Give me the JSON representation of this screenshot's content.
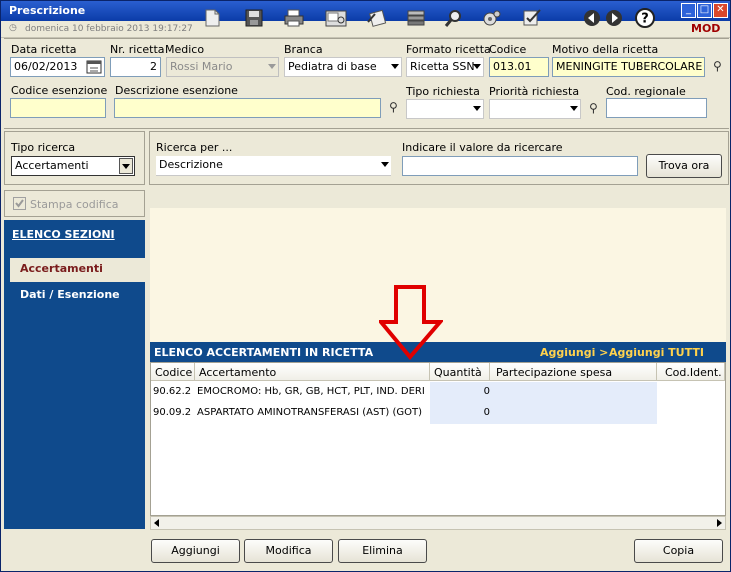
{
  "window": {
    "title": "Prescrizione",
    "date_info": "domenica 10 febbraio 2013   19:17:27",
    "mode": "MOD"
  },
  "toolbar": {
    "icons": [
      "new-doc-icon",
      "save-icon",
      "print-icon",
      "print-preview-icon",
      "attach-icon",
      "stack-icon",
      "search-icon",
      "settings-icon",
      "check-edit-icon",
      "prev-icon",
      "next-icon",
      "help-icon"
    ]
  },
  "header": {
    "data_ricetta_label": "Data ricetta",
    "data_ricetta_value": "06/02/2013",
    "nr_ricetta_label": "Nr. ricetta",
    "nr_ricetta_value": "2",
    "medico_label": "Medico",
    "medico_value": "Rossi Mario",
    "branca_label": "Branca",
    "branca_value": "Pediatra di base",
    "formato_label": "Formato ricetta",
    "formato_value": "Ricetta SSN",
    "codice_label": "Codice",
    "codice_value": "013.01",
    "motivo_label": "Motivo della ricetta",
    "motivo_value": "MENINGITE TUBERCOLARE",
    "codice_esenzione_label": "Codice esenzione",
    "codice_esenzione_value": "",
    "descrizione_esenzione_label": "Descrizione esenzione",
    "descrizione_esenzione_value": "",
    "tipo_richiesta_label": "Tipo richiesta",
    "tipo_richiesta_value": "",
    "priorita_label": "Priorità richiesta",
    "priorita_value": "",
    "cod_regionale_label": "Cod. regionale",
    "cod_regionale_value": ""
  },
  "search": {
    "tipo_ricerca_label": "Tipo ricerca",
    "tipo_ricerca_value": "Accertamenti",
    "ricerca_per_label": "Ricerca per ...",
    "ricerca_per_value": "Descrizione",
    "valore_label": "Indicare il valore da ricercare",
    "valore_value": "",
    "trova_button": "Trova ora",
    "stampa_codifica_label": "Stampa codifica"
  },
  "sidebar": {
    "title": "ELENCO SEZIONI",
    "items": [
      {
        "label": "Accertamenti",
        "active": true
      },
      {
        "label": "Dati / Esenzione",
        "active": false
      }
    ]
  },
  "list": {
    "title": "ELENCO ACCERTAMENTI IN RICETTA",
    "aggiungi": "Aggiungi >",
    "aggiungi_tutti": "Aggiungi TUTTI >>",
    "columns": [
      "Codice",
      "Accertamento",
      "Quantità",
      "Partecipazione spesa",
      "Cod.Ident."
    ],
    "rows": [
      {
        "codice": "90.62.2",
        "accertamento": "EMOCROMO: Hb, GR, GB, HCT, PLT, IND. DERI",
        "quantita": "0",
        "partecipazione": "",
        "cod_ident": ""
      },
      {
        "codice": "90.09.2",
        "accertamento": "ASPARTATO AMINOTRANSFERASI  (AST) (GOT)",
        "quantita": "0",
        "partecipazione": "",
        "cod_ident": ""
      }
    ]
  },
  "buttons": {
    "aggiungi": "Aggiungi",
    "modifica": "Modifica",
    "elimina": "Elimina",
    "copia": "Copia"
  },
  "colors": {
    "nav_blue": "#0f4a8c",
    "highlight_yellow": "#ffffcc",
    "mod_red": "#a00000",
    "annotation_arrow": "#e00000"
  }
}
